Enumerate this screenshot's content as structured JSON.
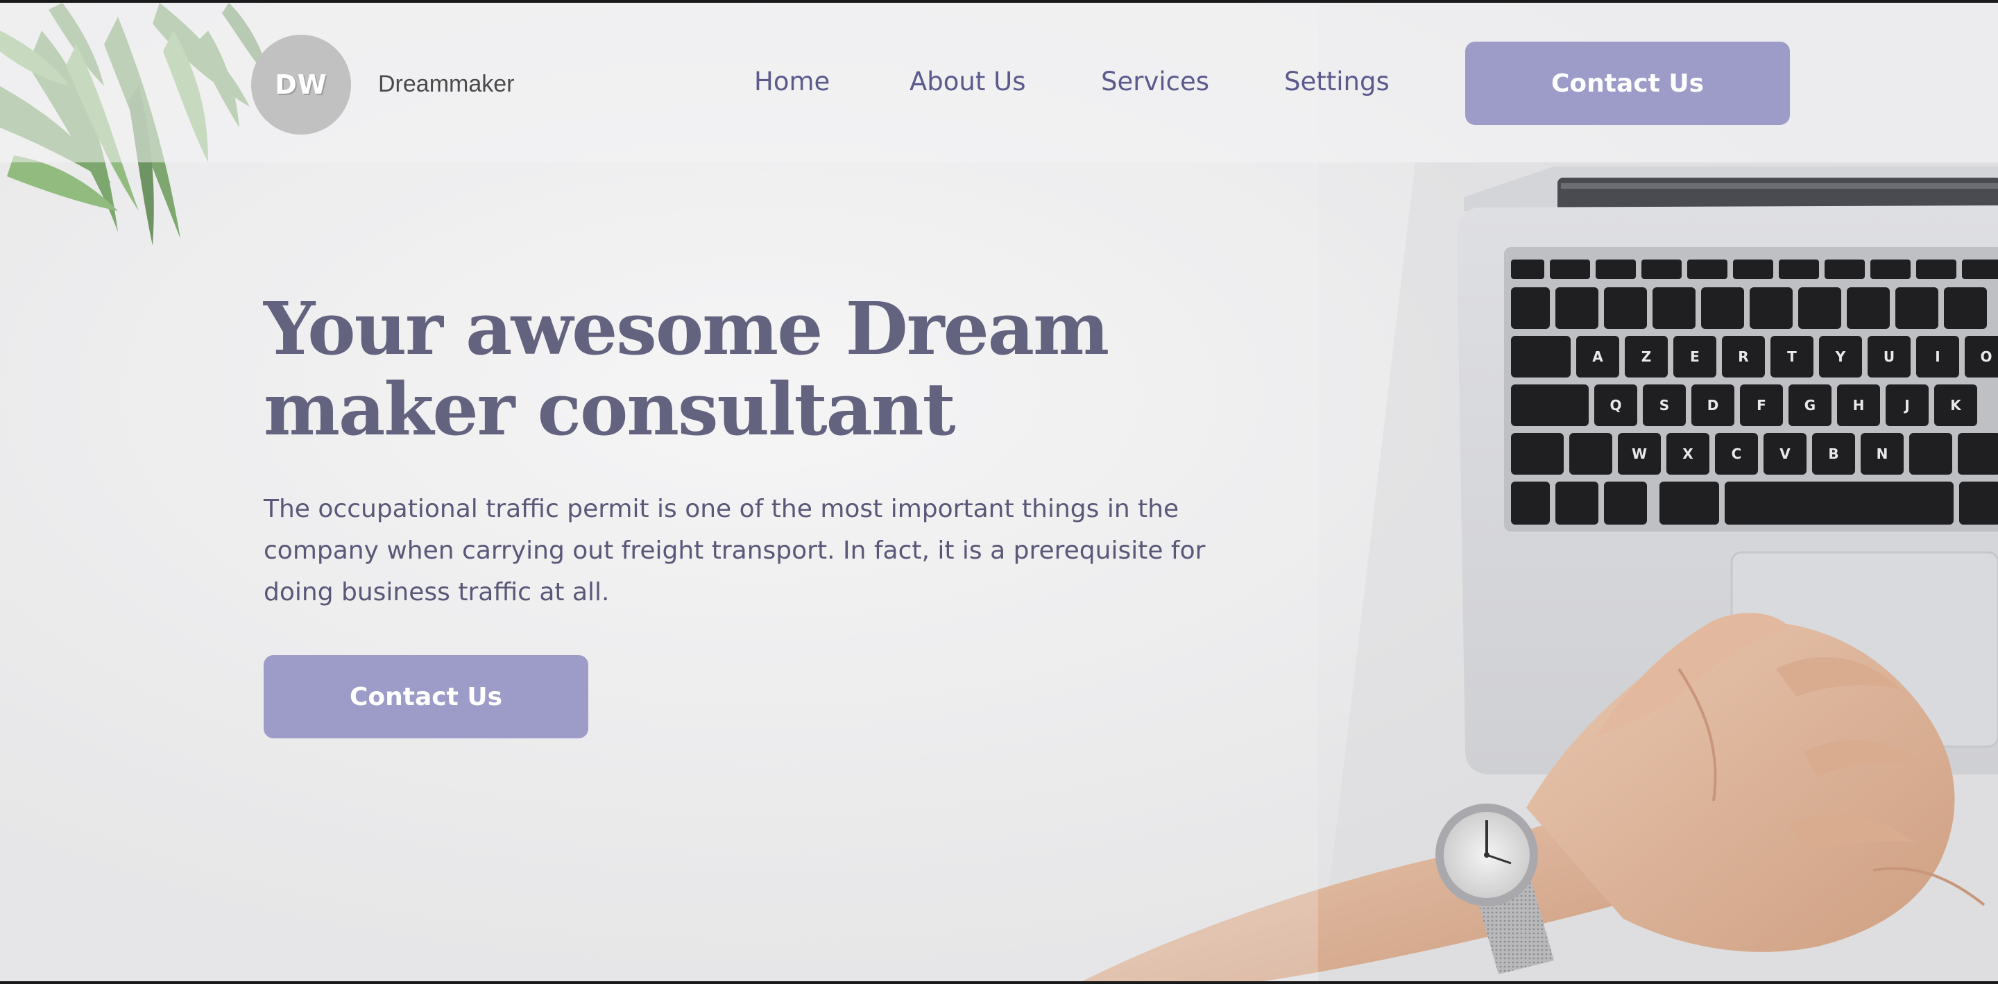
{
  "brand": {
    "logo_text": "DW",
    "name": "Dreammaker"
  },
  "nav": {
    "items": [
      {
        "label": "Home"
      },
      {
        "label": "About Us"
      },
      {
        "label": "Services"
      },
      {
        "label": "Settings"
      }
    ],
    "cta_label": "Contact Us"
  },
  "hero": {
    "title_line1": "Your awesome Dream",
    "title_line2": "maker consultant",
    "description": "The occupational traffic permit is one of the most important things in the company when carrying out freight transport. In fact, it is a prerequisite for doing business traffic at all.",
    "cta_label": "Contact Us"
  },
  "theme": {
    "accent": "#9d9cc9",
    "heading_color": "#63627f",
    "nav_color": "#5b5a8c"
  },
  "background": {
    "image": "desk-top-view-plant-laptop-hands-watch",
    "keyboard_keys": [
      "A",
      "Z",
      "E",
      "R",
      "T",
      "Y",
      "U",
      "I",
      "O",
      "Q",
      "S",
      "D",
      "F",
      "G",
      "H",
      "J",
      "K",
      "W",
      "X",
      "C",
      "V",
      "B",
      "N"
    ]
  }
}
